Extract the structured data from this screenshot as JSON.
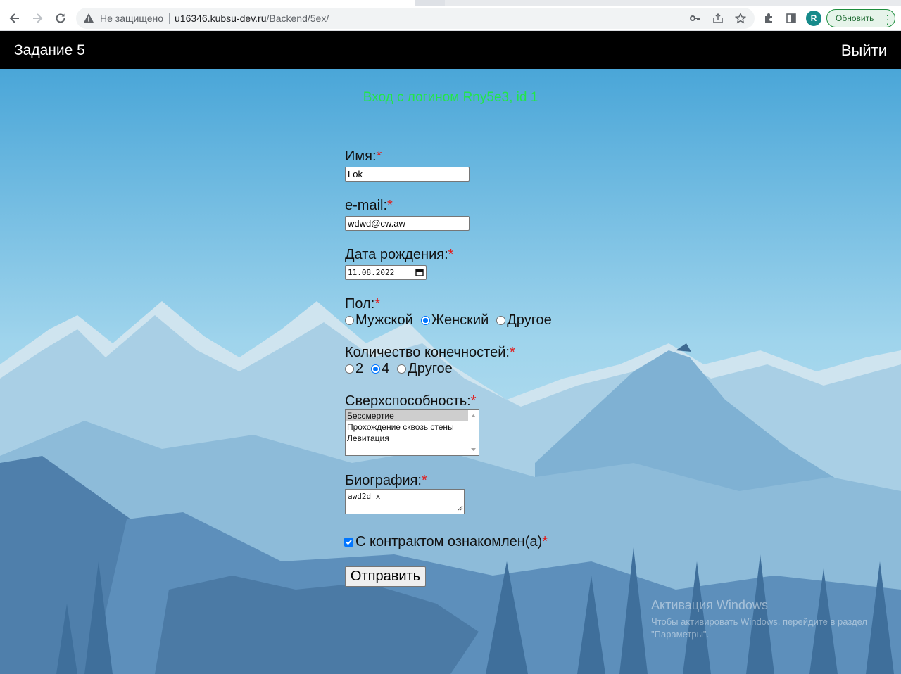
{
  "browser": {
    "security_label": "Не защищено",
    "url_domain": "u16346.kubsu-dev.ru",
    "url_path": "/Backend/5ex/",
    "profile_initial": "R",
    "update_label": "Обновить"
  },
  "header": {
    "title": "Задание 5",
    "logout_label": "Выйти"
  },
  "form": {
    "login_message": "Вход с логином Rny5e3, id 1",
    "required_mark": "*",
    "name": {
      "label": "Имя:",
      "value": "Lok"
    },
    "email": {
      "label": "e-mail:",
      "value": "wdwd@cw.aw"
    },
    "birthdate": {
      "label": "Дата рождения:",
      "value": "11.08.2022"
    },
    "gender": {
      "label": "Пол:",
      "options": [
        "Мужской",
        "Женский",
        "Другое"
      ],
      "selected": "Женский"
    },
    "limbs": {
      "label": "Количество конечностей:",
      "options": [
        "2",
        "4",
        "Другое"
      ],
      "selected": "4"
    },
    "abilities": {
      "label": "Сверхспособность:",
      "options": [
        "Бессмертие",
        "Прохождение сквозь стены",
        "Левитация"
      ],
      "selected": "Бессмертие"
    },
    "bio": {
      "label": "Биография:",
      "value": "awd2d  x"
    },
    "contract": {
      "label": "С контрактом ознакомлен(а)",
      "checked": true
    },
    "submit_label": "Отправить"
  },
  "watermark": {
    "title": "Активация Windows",
    "text": "Чтобы активировать Windows, перейдите в раздел \"Параметры\"."
  }
}
